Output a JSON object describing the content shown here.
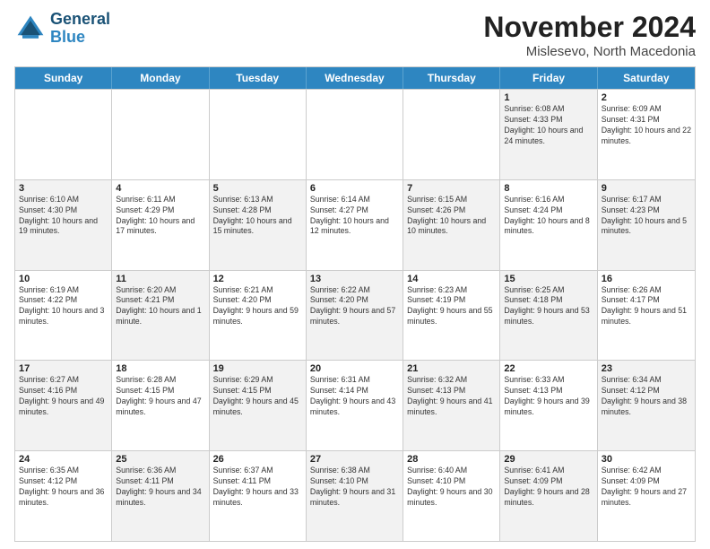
{
  "header": {
    "logo_line1": "General",
    "logo_line2": "Blue",
    "month_title": "November 2024",
    "location": "Mislesevo, North Macedonia"
  },
  "days_of_week": [
    "Sunday",
    "Monday",
    "Tuesday",
    "Wednesday",
    "Thursday",
    "Friday",
    "Saturday"
  ],
  "weeks": [
    [
      {
        "day": "",
        "info": "",
        "shaded": false,
        "empty": true
      },
      {
        "day": "",
        "info": "",
        "shaded": false,
        "empty": true
      },
      {
        "day": "",
        "info": "",
        "shaded": false,
        "empty": true
      },
      {
        "day": "",
        "info": "",
        "shaded": false,
        "empty": true
      },
      {
        "day": "",
        "info": "",
        "shaded": false,
        "empty": true
      },
      {
        "day": "1",
        "info": "Sunrise: 6:08 AM\nSunset: 4:33 PM\nDaylight: 10 hours and 24 minutes.",
        "shaded": true
      },
      {
        "day": "2",
        "info": "Sunrise: 6:09 AM\nSunset: 4:31 PM\nDaylight: 10 hours and 22 minutes.",
        "shaded": false
      }
    ],
    [
      {
        "day": "3",
        "info": "Sunrise: 6:10 AM\nSunset: 4:30 PM\nDaylight: 10 hours and 19 minutes.",
        "shaded": true
      },
      {
        "day": "4",
        "info": "Sunrise: 6:11 AM\nSunset: 4:29 PM\nDaylight: 10 hours and 17 minutes.",
        "shaded": false
      },
      {
        "day": "5",
        "info": "Sunrise: 6:13 AM\nSunset: 4:28 PM\nDaylight: 10 hours and 15 minutes.",
        "shaded": true
      },
      {
        "day": "6",
        "info": "Sunrise: 6:14 AM\nSunset: 4:27 PM\nDaylight: 10 hours and 12 minutes.",
        "shaded": false
      },
      {
        "day": "7",
        "info": "Sunrise: 6:15 AM\nSunset: 4:26 PM\nDaylight: 10 hours and 10 minutes.",
        "shaded": true
      },
      {
        "day": "8",
        "info": "Sunrise: 6:16 AM\nSunset: 4:24 PM\nDaylight: 10 hours and 8 minutes.",
        "shaded": false
      },
      {
        "day": "9",
        "info": "Sunrise: 6:17 AM\nSunset: 4:23 PM\nDaylight: 10 hours and 5 minutes.",
        "shaded": true
      }
    ],
    [
      {
        "day": "10",
        "info": "Sunrise: 6:19 AM\nSunset: 4:22 PM\nDaylight: 10 hours and 3 minutes.",
        "shaded": false
      },
      {
        "day": "11",
        "info": "Sunrise: 6:20 AM\nSunset: 4:21 PM\nDaylight: 10 hours and 1 minute.",
        "shaded": true
      },
      {
        "day": "12",
        "info": "Sunrise: 6:21 AM\nSunset: 4:20 PM\nDaylight: 9 hours and 59 minutes.",
        "shaded": false
      },
      {
        "day": "13",
        "info": "Sunrise: 6:22 AM\nSunset: 4:20 PM\nDaylight: 9 hours and 57 minutes.",
        "shaded": true
      },
      {
        "day": "14",
        "info": "Sunrise: 6:23 AM\nSunset: 4:19 PM\nDaylight: 9 hours and 55 minutes.",
        "shaded": false
      },
      {
        "day": "15",
        "info": "Sunrise: 6:25 AM\nSunset: 4:18 PM\nDaylight: 9 hours and 53 minutes.",
        "shaded": true
      },
      {
        "day": "16",
        "info": "Sunrise: 6:26 AM\nSunset: 4:17 PM\nDaylight: 9 hours and 51 minutes.",
        "shaded": false
      }
    ],
    [
      {
        "day": "17",
        "info": "Sunrise: 6:27 AM\nSunset: 4:16 PM\nDaylight: 9 hours and 49 minutes.",
        "shaded": true
      },
      {
        "day": "18",
        "info": "Sunrise: 6:28 AM\nSunset: 4:15 PM\nDaylight: 9 hours and 47 minutes.",
        "shaded": false
      },
      {
        "day": "19",
        "info": "Sunrise: 6:29 AM\nSunset: 4:15 PM\nDaylight: 9 hours and 45 minutes.",
        "shaded": true
      },
      {
        "day": "20",
        "info": "Sunrise: 6:31 AM\nSunset: 4:14 PM\nDaylight: 9 hours and 43 minutes.",
        "shaded": false
      },
      {
        "day": "21",
        "info": "Sunrise: 6:32 AM\nSunset: 4:13 PM\nDaylight: 9 hours and 41 minutes.",
        "shaded": true
      },
      {
        "day": "22",
        "info": "Sunrise: 6:33 AM\nSunset: 4:13 PM\nDaylight: 9 hours and 39 minutes.",
        "shaded": false
      },
      {
        "day": "23",
        "info": "Sunrise: 6:34 AM\nSunset: 4:12 PM\nDaylight: 9 hours and 38 minutes.",
        "shaded": true
      }
    ],
    [
      {
        "day": "24",
        "info": "Sunrise: 6:35 AM\nSunset: 4:12 PM\nDaylight: 9 hours and 36 minutes.",
        "shaded": false
      },
      {
        "day": "25",
        "info": "Sunrise: 6:36 AM\nSunset: 4:11 PM\nDaylight: 9 hours and 34 minutes.",
        "shaded": true
      },
      {
        "day": "26",
        "info": "Sunrise: 6:37 AM\nSunset: 4:11 PM\nDaylight: 9 hours and 33 minutes.",
        "shaded": false
      },
      {
        "day": "27",
        "info": "Sunrise: 6:38 AM\nSunset: 4:10 PM\nDaylight: 9 hours and 31 minutes.",
        "shaded": true
      },
      {
        "day": "28",
        "info": "Sunrise: 6:40 AM\nSunset: 4:10 PM\nDaylight: 9 hours and 30 minutes.",
        "shaded": false
      },
      {
        "day": "29",
        "info": "Sunrise: 6:41 AM\nSunset: 4:09 PM\nDaylight: 9 hours and 28 minutes.",
        "shaded": true
      },
      {
        "day": "30",
        "info": "Sunrise: 6:42 AM\nSunset: 4:09 PM\nDaylight: 9 hours and 27 minutes.",
        "shaded": false
      }
    ]
  ]
}
